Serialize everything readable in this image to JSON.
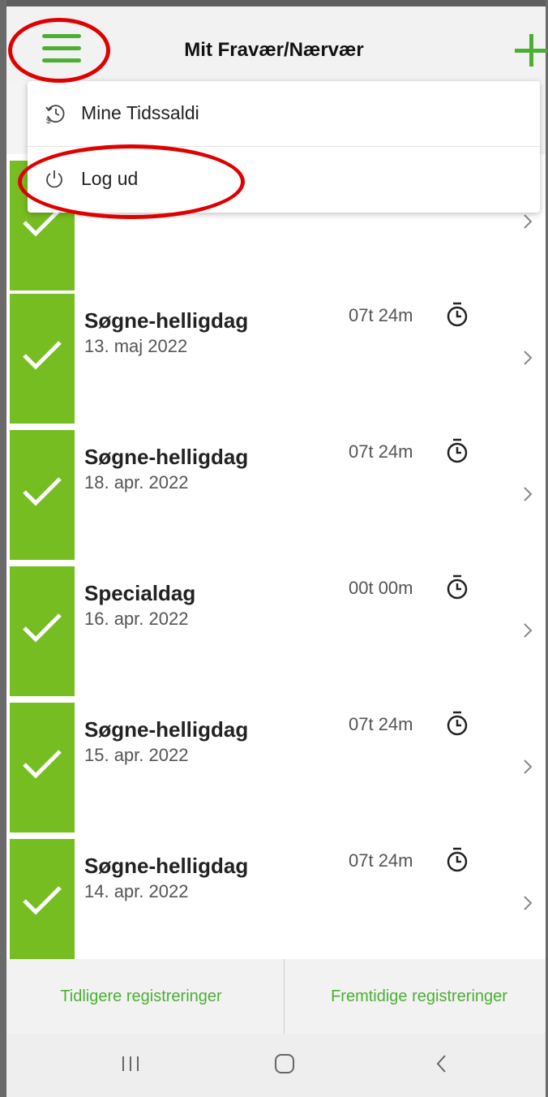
{
  "header": {
    "title": "Mit Fravær/Nærvær",
    "menu_icon": "hamburger-icon",
    "add_icon": "plus-icon"
  },
  "dropdown": {
    "items": [
      {
        "label": "Mine Tidssaldi",
        "icon": "time-balance-icon"
      },
      {
        "label": "Log ud",
        "icon": "power-icon"
      }
    ]
  },
  "entries": [
    {
      "title": "",
      "date": "",
      "time": ""
    },
    {
      "title": "Søgne-helligdag",
      "date": "13. maj 2022",
      "time": "07t 24m"
    },
    {
      "title": "Søgne-helligdag",
      "date": "18. apr. 2022",
      "time": "07t 24m"
    },
    {
      "title": "Specialdag",
      "date": "16. apr. 2022",
      "time": "00t 00m"
    },
    {
      "title": "Søgne-helligdag",
      "date": "15. apr. 2022",
      "time": "07t 24m"
    },
    {
      "title": "Søgne-helligdag",
      "date": "14. apr. 2022",
      "time": "07t 24m"
    }
  ],
  "footer": {
    "left_tab": "Tidligere registreringer",
    "right_tab": "Fremtidige registreringer"
  },
  "colors": {
    "accent": "#4caf34",
    "check_bg": "#76bd22",
    "annotation": "#e00000"
  }
}
